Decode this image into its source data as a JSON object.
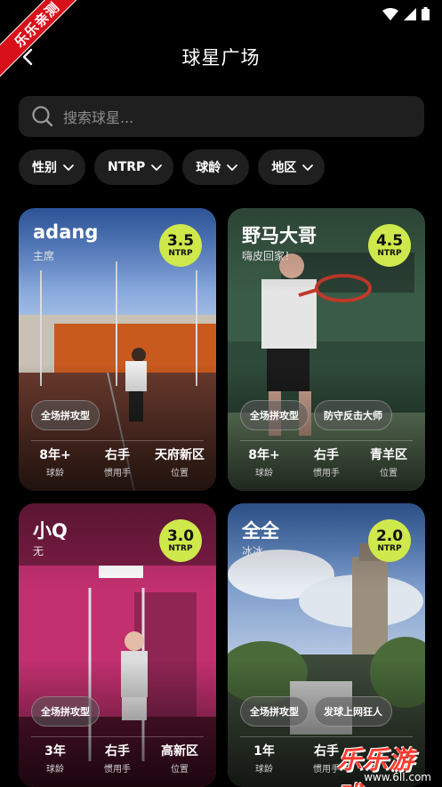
{
  "header": {
    "title": "球星广场"
  },
  "watermark": {
    "ribbon": "乐乐亲测",
    "brand": "乐乐游戏",
    "url": "www.6ll.com"
  },
  "search": {
    "placeholder": "搜索球星..."
  },
  "filters": [
    {
      "label": "性别"
    },
    {
      "label": "NTRP"
    },
    {
      "label": "球龄"
    },
    {
      "label": "地区"
    }
  ],
  "players": [
    {
      "name": "adang",
      "subtitle": "主席",
      "rating": "3.5",
      "rating_label": "NTRP",
      "tags": [
        "全场拼攻型"
      ],
      "stats": [
        {
          "value": "8年+",
          "label": "球龄"
        },
        {
          "value": "右手",
          "label": "惯用手"
        },
        {
          "value": "天府新区",
          "label": "位置"
        }
      ]
    },
    {
      "name": "野马大哥",
      "subtitle": "嗨皮回家！",
      "rating": "4.5",
      "rating_label": "NTRP",
      "tags": [
        "全场拼攻型",
        "防守反击大师"
      ],
      "stats": [
        {
          "value": "8年+",
          "label": "球龄"
        },
        {
          "value": "右手",
          "label": "惯用手"
        },
        {
          "value": "青羊区",
          "label": "位置"
        }
      ]
    },
    {
      "name": "小Q",
      "subtitle": "无",
      "rating": "3.0",
      "rating_label": "NTRP",
      "tags": [
        "全场拼攻型"
      ],
      "stats": [
        {
          "value": "3年",
          "label": "球龄"
        },
        {
          "value": "右手",
          "label": "惯用手"
        },
        {
          "value": "高新区",
          "label": "位置"
        }
      ]
    },
    {
      "name": "全全",
      "subtitle": "冰冰",
      "rating": "2.0",
      "rating_label": "NTRP",
      "tags": [
        "全场拼攻型",
        "发球上网狂人"
      ],
      "stats": [
        {
          "value": "1年",
          "label": "球龄"
        },
        {
          "value": "右手",
          "label": "惯用手"
        },
        {
          "value": "",
          "label": ""
        }
      ]
    }
  ],
  "colors": {
    "accent": "#cfe84c",
    "background": "#000000",
    "surface": "#1f1f1f"
  }
}
